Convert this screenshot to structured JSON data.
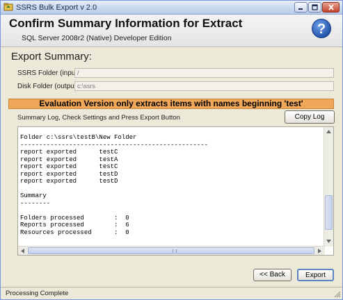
{
  "window": {
    "title": "SSRS Bulk Export v 2.0"
  },
  "header": {
    "title": "Confirm Summary Information for Extract",
    "edition": "SQL Server 2008r2 (Native) Developer Edition"
  },
  "summary": {
    "heading": "Export Summary:",
    "ssrs_folder_label": "SSRS Folder (input)",
    "ssrs_folder_value": "/",
    "disk_folder_label": "Disk Folder (output)",
    "disk_folder_value": "c:\\ssrs"
  },
  "banner": {
    "text": "Evaluation Version only extracts items with names beginning 'test'",
    "color": "#f0a75a"
  },
  "log": {
    "label": "Summary Log, Check Settings and Press Export Button",
    "copy_button": "Copy Log",
    "text": "Folder c:\\ssrs\\testB\\New Folder\n--------------------------------------------------\nreport exported      testC\nreport exported      testA\nreport exported      testC\nreport exported      testD\nreport exported      testD\n\nSummary\n--------\n\nFolders processed        :  0\nReports processed        :  6\nResources processed      :  0"
  },
  "buttons": {
    "back": "<< Back",
    "export": "Export"
  },
  "status": {
    "text": "Processing Complete"
  },
  "icons": {
    "app": "app-icon",
    "help": "help-icon",
    "minimize": "minimize-icon",
    "maximize": "maximize-icon",
    "close": "close-icon"
  }
}
